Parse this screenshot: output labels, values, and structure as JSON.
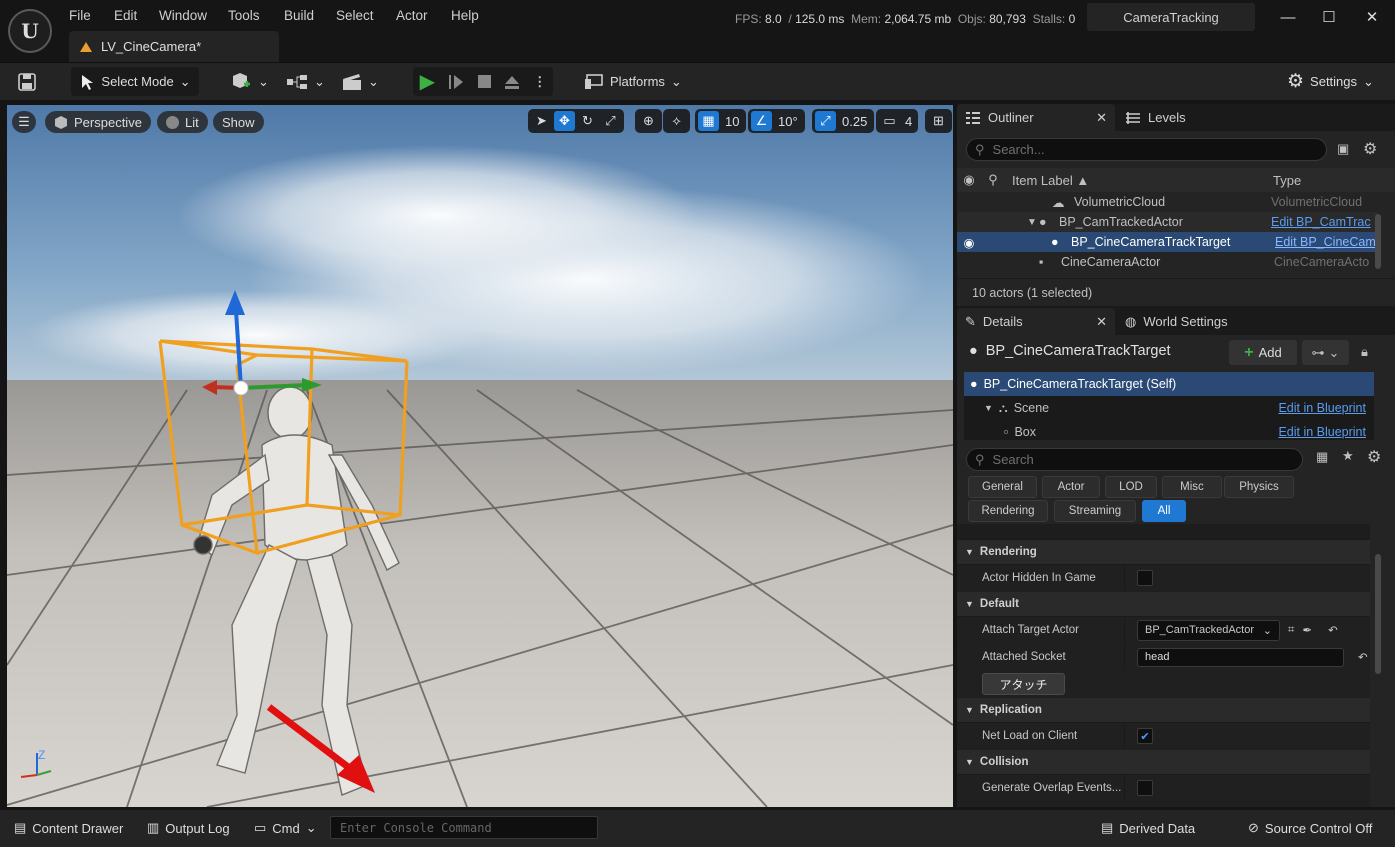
{
  "app": {
    "logo": "U"
  },
  "menu": [
    "File",
    "Edit",
    "Window",
    "Tools",
    "Build",
    "Select",
    "Actor",
    "Help"
  ],
  "document_tab": {
    "title": "LV_CineCamera*"
  },
  "stats": {
    "fps_label": "FPS:",
    "fps": "8.0",
    "ms_label": "/",
    "ms": "125.0 ms",
    "mem_label": "Mem:",
    "mem": "2,064.75 mb",
    "objs_label": "Objs:",
    "objs": "80,793",
    "stalls_label": "Stalls:",
    "stalls": "0"
  },
  "project": "CameraTracking",
  "window_controls": {
    "minimize": "—",
    "maximize": "☐",
    "close": "✕"
  },
  "toolbar": {
    "select_mode": "Select Mode",
    "platforms": "Platforms",
    "settings": "Settings"
  },
  "viewport": {
    "perspective": "Perspective",
    "lit": "Lit",
    "show": "Show",
    "grid_snap": "10",
    "rot_snap": "10°",
    "scale_snap": "0.25",
    "camera_speed": "4",
    "axis_z": "Z"
  },
  "outliner": {
    "tab": "Outliner",
    "levels_tab": "Levels",
    "search_placeholder": "Search...",
    "col_label": "Item Label ▲",
    "col_type": "Type",
    "rows": [
      {
        "label": "VolumetricCloud",
        "type": "VolumetricCloud"
      },
      {
        "label": "BP_CamTrackedActor",
        "type": "Edit BP_CamTrac"
      },
      {
        "label": "BP_CineCameraTrackTarget",
        "type": "Edit BP_CineCam"
      },
      {
        "label": "CineCameraActor",
        "type": "CineCameraActo"
      }
    ],
    "status": "10 actors (1 selected)"
  },
  "details": {
    "tab": "Details",
    "world_tab": "World Settings",
    "actor_name": "BP_CineCameraTrackTarget",
    "add_label": "Add",
    "components": [
      {
        "label": "BP_CineCameraTrackTarget (Self)",
        "link": ""
      },
      {
        "label": "Scene",
        "link": "Edit in Blueprint"
      },
      {
        "label": "Box",
        "link": "Edit in Blueprint"
      }
    ],
    "search_placeholder": "Search",
    "filters_row1": [
      "General",
      "Actor",
      "LOD",
      "Misc",
      "Physics"
    ],
    "filters_row2": [
      "Rendering",
      "Streaming",
      "All"
    ],
    "cat_rendering": "Rendering",
    "prop_hidden": "Actor Hidden In Game",
    "cat_default": "Default",
    "prop_attach_target": "Attach Target Actor",
    "attach_target_value": "BP_CamTrackedActor",
    "prop_socket": "Attached Socket",
    "socket_value": "head",
    "attach_button": "アタッチ",
    "cat_replication": "Replication",
    "prop_netload": "Net Load on Client",
    "cat_collision": "Collision",
    "prop_overlap": "Generate Overlap Events..."
  },
  "bottombar": {
    "content_drawer": "Content Drawer",
    "output_log": "Output Log",
    "cmd": "Cmd",
    "console_placeholder": "Enter Console Command",
    "derived_data": "Derived Data",
    "source_control": "Source Control Off"
  },
  "colors": {
    "accent": "#1f78d1",
    "selection": "#2a4a75",
    "link": "#5a9cf0",
    "play": "#3cb043"
  }
}
